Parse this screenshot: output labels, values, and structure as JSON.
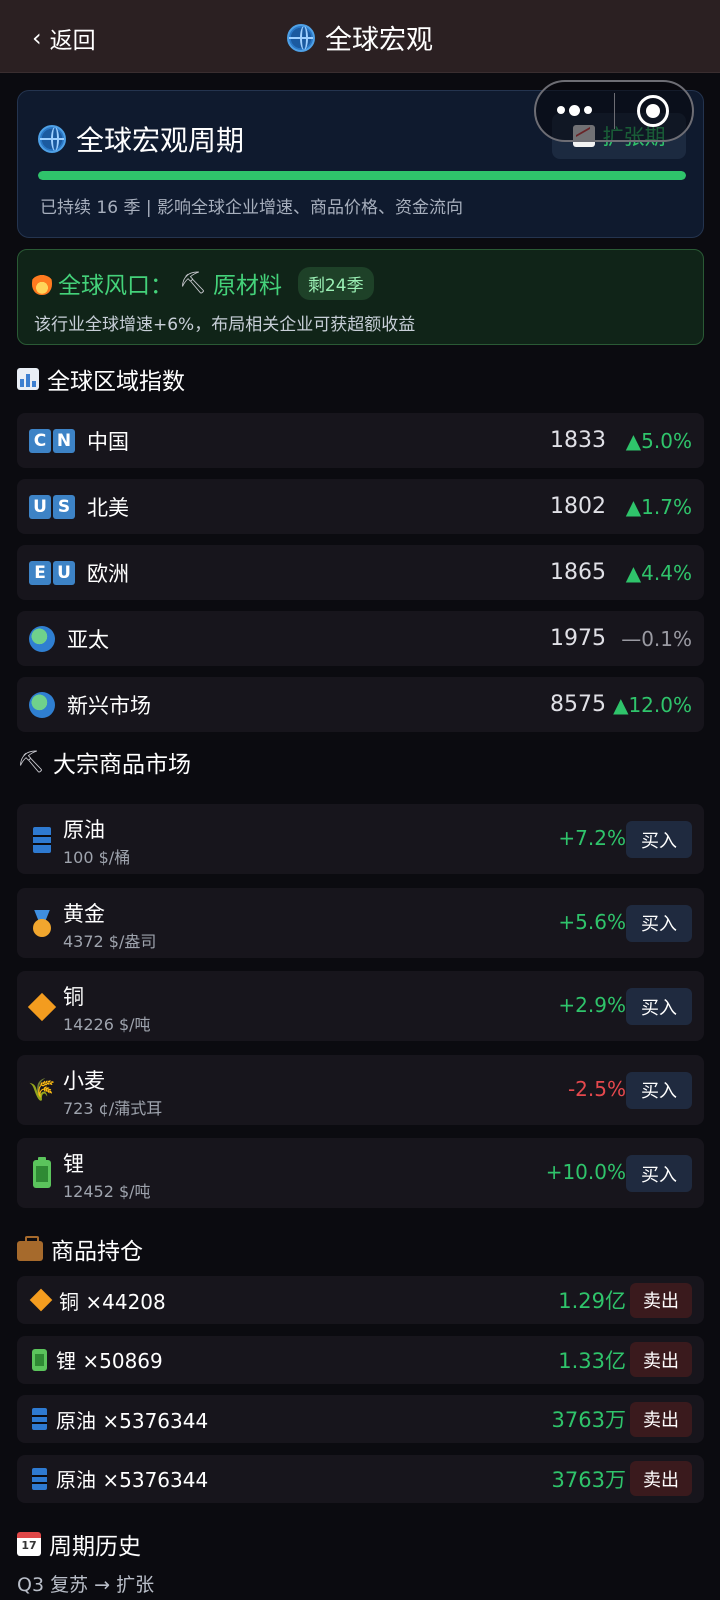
{
  "header": {
    "back_label": "返回",
    "title": "全球宏观"
  },
  "macro": {
    "title": "全球宏观周期",
    "phase_badge": "扩张期",
    "progress_pct": 100,
    "subtitle": "已持续 16 季 | 影响全球企业增速、商品价格、资金流向"
  },
  "wind": {
    "label": "全球风口：",
    "sector": "原材料",
    "remaining": "剩24季",
    "desc": "该行业全球增速+6%，布局相关企业可获超额收益"
  },
  "regions": {
    "title": "全球区域指数",
    "items": [
      {
        "code": [
          "C",
          "N"
        ],
        "name": "中国",
        "value": "1833",
        "change": "▲5.0%",
        "trend": "up"
      },
      {
        "code": [
          "U",
          "S"
        ],
        "name": "北美",
        "value": "1802",
        "change": "▲1.7%",
        "trend": "up"
      },
      {
        "code": [
          "E",
          "U"
        ],
        "name": "欧洲",
        "value": "1865",
        "change": "▲4.4%",
        "trend": "up"
      },
      {
        "code": null,
        "name": "亚太",
        "value": "1975",
        "change": "—0.1%",
        "trend": "flat"
      },
      {
        "code": null,
        "name": "新兴市场",
        "value": "8575",
        "change": "▲12.0%",
        "trend": "up"
      }
    ]
  },
  "commodities": {
    "title": "大宗商品市场",
    "buy_label": "买入",
    "items": [
      {
        "icon": "oil-barrel-icon",
        "name": "原油",
        "price": "100 $/桶",
        "change": "+7.2%",
        "trend": "up"
      },
      {
        "icon": "gold-medal-icon",
        "name": "黄金",
        "price": "4372 $/盎司",
        "change": "+5.6%",
        "trend": "up"
      },
      {
        "icon": "copper-diamond-icon",
        "name": "铜",
        "price": "14226 $/吨",
        "change": "+2.9%",
        "trend": "up"
      },
      {
        "icon": "wheat-icon",
        "name": "小麦",
        "price": "723 ¢/蒲式耳",
        "change": "-2.5%",
        "trend": "down"
      },
      {
        "icon": "battery-icon",
        "name": "锂",
        "price": "12452 $/吨",
        "change": "+10.0%",
        "trend": "up"
      }
    ]
  },
  "holdings": {
    "title": "商品持仓",
    "sell_label": "卖出",
    "items": [
      {
        "icon": "copper-diamond-icon",
        "name": "铜 ×44208",
        "value": "1.29亿"
      },
      {
        "icon": "battery-icon",
        "name": "锂 ×50869",
        "value": "1.33亿"
      },
      {
        "icon": "oil-barrel-icon",
        "name": "原油 ×5376344",
        "value": "3763万"
      },
      {
        "icon": "oil-barrel-icon",
        "name": "原油 ×5376344",
        "value": "3763万"
      }
    ]
  },
  "history": {
    "title": "周期历史",
    "calendar_text": "17",
    "entry": "Q3 复苏 → 扩张"
  },
  "colors": {
    "up": "#2fc46b",
    "down": "#e5484d",
    "flat": "#9a9aa2",
    "accent": "#2fc46b"
  }
}
